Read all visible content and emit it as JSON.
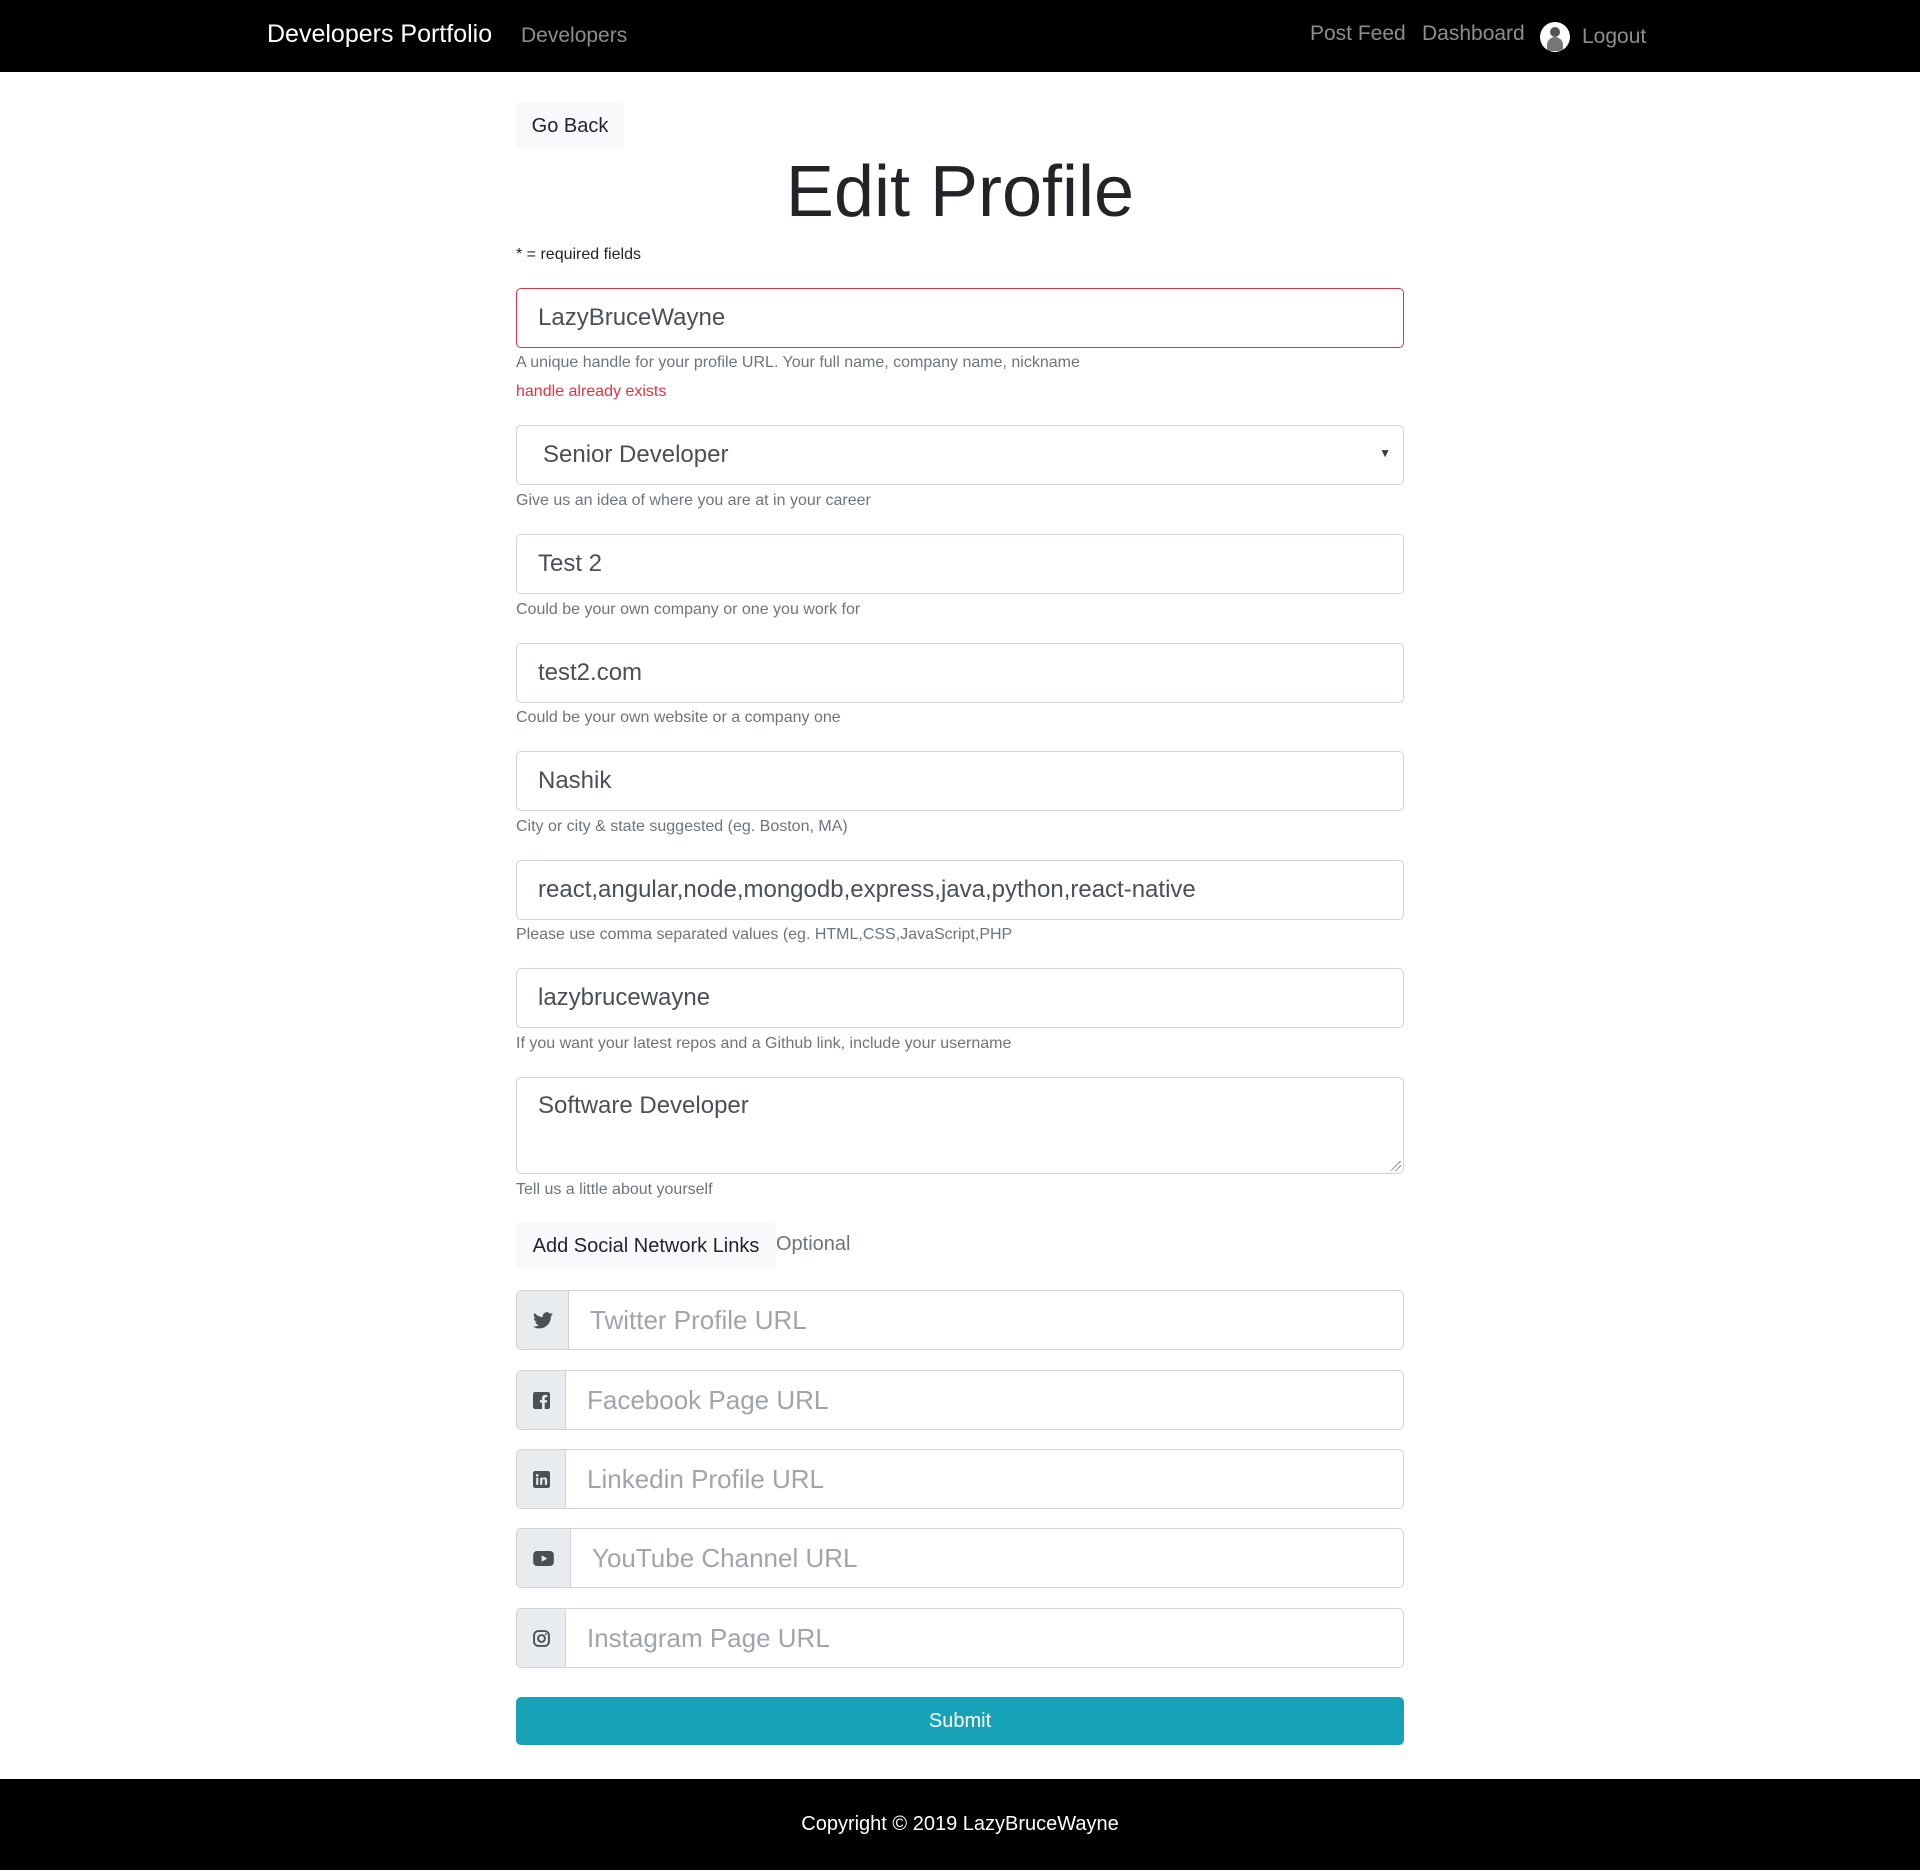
{
  "navbar": {
    "brand": "Developers Portfolio",
    "developers": "Developers",
    "post_feed": "Post Feed",
    "dashboard": "Dashboard",
    "logout": "Logout"
  },
  "go_back": "Go Back",
  "title": "Edit Profile",
  "required_note": "* = required fields",
  "fields": {
    "handle": {
      "value": "LazyBruceWayne",
      "help": "A unique handle for your profile URL. Your full name, company name, nickname",
      "error": "handle already exists"
    },
    "status": {
      "value": "Senior Developer",
      "help": "Give us an idea of where you are at in your career"
    },
    "company": {
      "value": "Test 2",
      "help": "Could be your own company or one you work for"
    },
    "website": {
      "value": "test2.com",
      "help": "Could be your own website or a company one"
    },
    "location": {
      "value": "Nashik",
      "help": "City or city & state suggested (eg. Boston, MA)"
    },
    "skills": {
      "value": "react,angular,node,mongodb,express,java,python,react-native",
      "help": "Please use comma separated values (eg. HTML,CSS,JavaScript,PHP"
    },
    "github": {
      "value": "lazybrucewayne",
      "help": "If you want your latest repos and a Github link, include your username"
    },
    "bio": {
      "value": "Software Developer",
      "help": "Tell us a little about yourself"
    }
  },
  "social": {
    "button": "Add Social Network Links",
    "optional": "Optional",
    "twitter": {
      "placeholder": "Twitter Profile URL",
      "icon": "twitter-icon"
    },
    "facebook": {
      "placeholder": "Facebook Page URL",
      "icon": "facebook-icon"
    },
    "linkedin": {
      "placeholder": "Linkedin Profile URL",
      "icon": "linkedin-icon"
    },
    "youtube": {
      "placeholder": "YouTube Channel URL",
      "icon": "youtube-icon"
    },
    "instagram": {
      "placeholder": "Instagram Page URL",
      "icon": "instagram-icon"
    }
  },
  "submit": "Submit",
  "footer": "Copyright © 2019 LazyBruceWayne",
  "colors": {
    "navbar": "#000000",
    "submit": "#17a2b8",
    "error": "#dc3545",
    "muted": "#6c757d"
  }
}
